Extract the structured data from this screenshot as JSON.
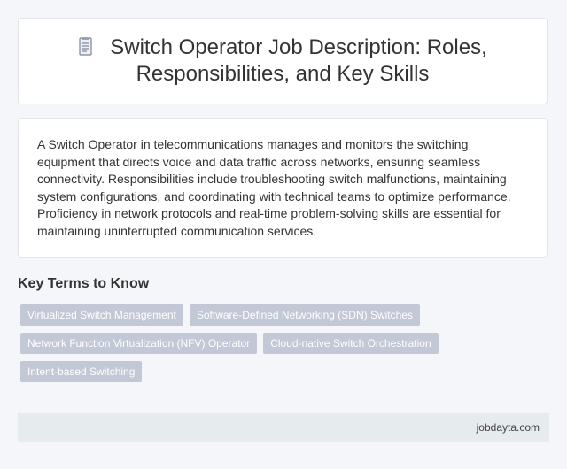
{
  "header": {
    "icon": "document-icon",
    "title_line1": "Switch Operator Job Description: Roles,",
    "title_line2": "Responsibilities, and Key Skills"
  },
  "description": "A Switch Operator in telecommunications manages and monitors the switching equipment that directs voice and data traffic across networks, ensuring seamless connectivity. Responsibilities include troubleshooting switch malfunctions, maintaining system configurations, and coordinating with technical teams to optimize performance. Proficiency in network protocols and real-time problem-solving skills are essential for maintaining uninterrupted communication services.",
  "key_terms": {
    "heading": "Key Terms to Know",
    "tags": [
      "Virtualized Switch Management",
      "Software-Defined Networking (SDN) Switches",
      "Network Function Virtualization (NFV) Operator",
      "Cloud-native Switch Orchestration",
      "Intent-based Switching"
    ]
  },
  "footer": {
    "site": "jobdayta.com"
  },
  "colors": {
    "tag_bg": "#c3c8d6",
    "footer_bg": "#e6ebee",
    "page_bg": "#f4f6f9"
  }
}
